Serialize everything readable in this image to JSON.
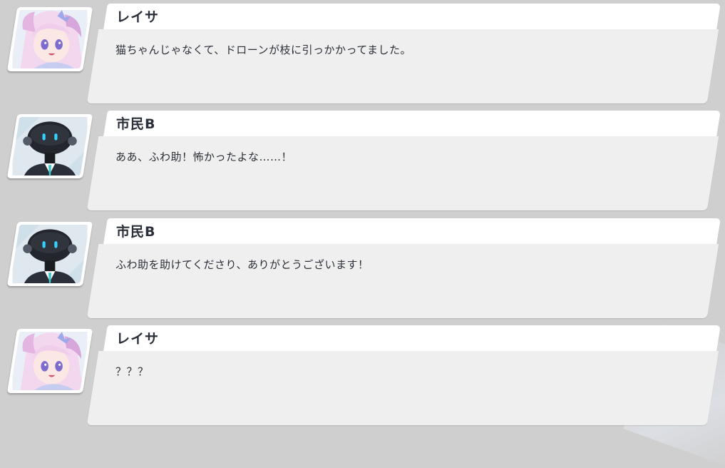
{
  "messages": [
    {
      "speaker": "レイサ",
      "avatar": "reisa-avatar",
      "text": "猫ちゃんじゃなくて、ドローンが枝に引っかかってました。"
    },
    {
      "speaker": "市民B",
      "avatar": "robot-citizen-avatar",
      "text": "ああ、ふわ助！怖かったよな……！"
    },
    {
      "speaker": "市民B",
      "avatar": "robot-citizen-avatar",
      "text": "ふわ助を助けてくださり、ありがとうございます！"
    },
    {
      "speaker": "レイサ",
      "avatar": "reisa-avatar",
      "text": "？？？"
    }
  ],
  "colors": {
    "background": "#cfcfcf",
    "name_tab": "#ffffff",
    "message_box": "#efefef",
    "text": "#2b2f38",
    "robot_eye": "#32d4ff"
  }
}
